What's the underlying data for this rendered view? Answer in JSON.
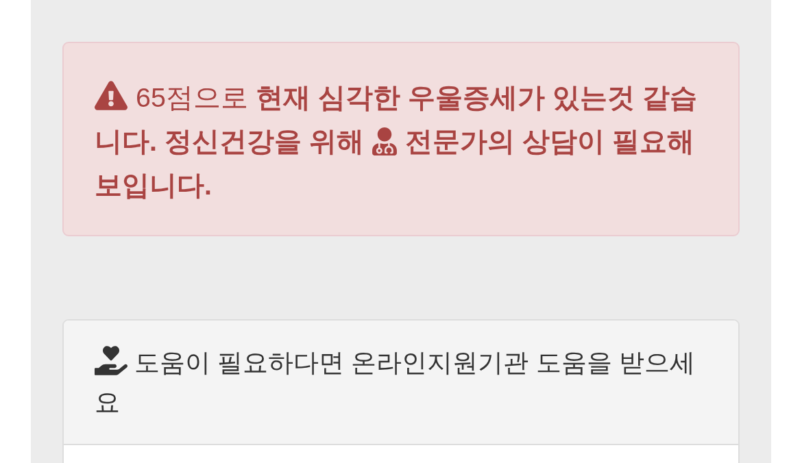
{
  "alert": {
    "line_1": "65점으로 **현재 심각한 우울증세가 있는것 같습**",
    "line_2_start": "니다. 정신건강을 위해",
    "line_2_end": "전문가의 상담이 필요해",
    "line_3": "보입니다."
  },
  "help_panel": {
    "heading_line_1": "도움이 필요하다면 온라인지원기관 도움을 받으세",
    "heading_line_2": "요"
  }
}
